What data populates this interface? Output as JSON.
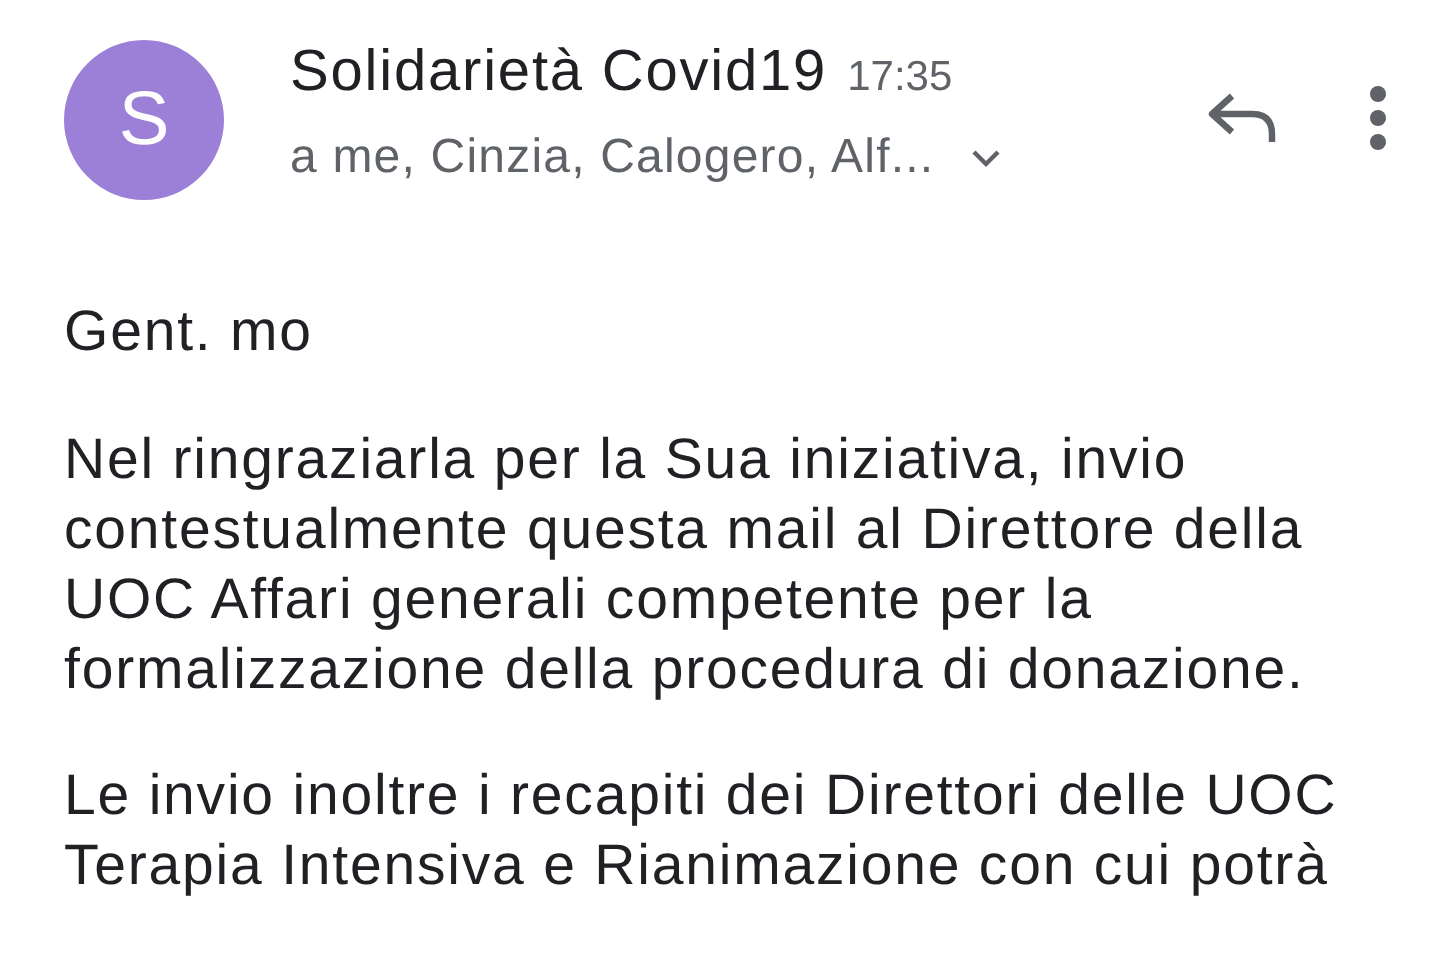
{
  "message": {
    "sender": "Solidarietà Covid19",
    "avatar_letter": "S",
    "time": "17:35",
    "recipients": "a me, Cinzia, Calogero, Alf...",
    "recipients_expanded": false
  },
  "body": {
    "greeting": "Gent. mo",
    "paragraphs": [
      "Nel ringraziarla per la Sua iniziativa, invio contestualmente questa mail al Direttore della UOC Affari generali competente per la formalizzazione della procedura di donazione.",
      "Le invio inoltre i recapiti dei Direttori delle UOC Terapia Intensiva e Rianimazione con cui potrà"
    ]
  }
}
